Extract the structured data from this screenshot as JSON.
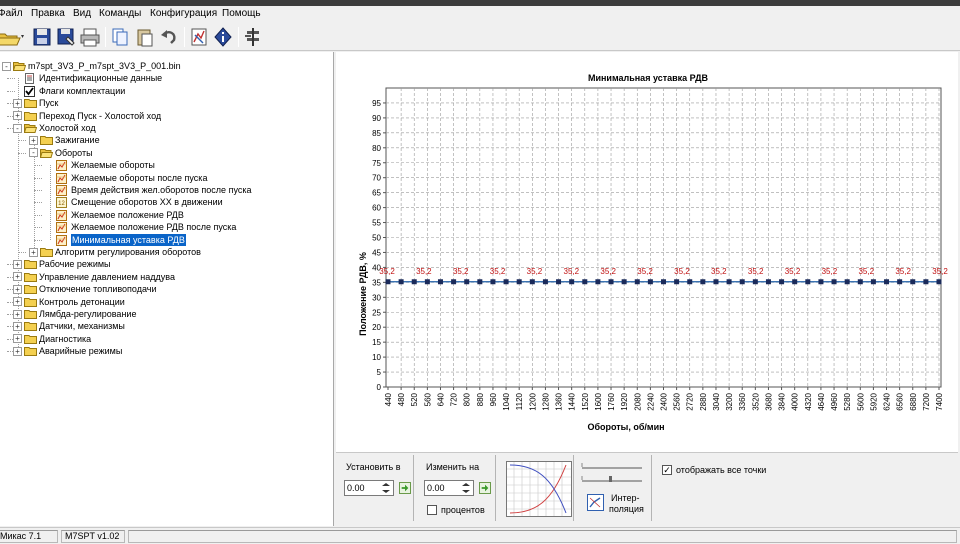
{
  "menu": [
    {
      "label": "Файл"
    },
    {
      "label": "Правка"
    },
    {
      "label": "Вид"
    },
    {
      "label": "Команды"
    },
    {
      "label": "Конфигурация"
    },
    {
      "label": "Помощь"
    }
  ],
  "tree": {
    "root": "m7spt_3V3_P_m7spt_3V3_P_001.bin",
    "nodes": [
      {
        "label": "Идентификационные данные",
        "icon": "id-icon"
      },
      {
        "label": "Флаги комплектации",
        "icon": "checkmark-icon"
      },
      {
        "label": "Пуск",
        "icon": "folder-icon"
      },
      {
        "label": "Переход Пуск - Холостой ход",
        "icon": "folder-icon"
      },
      {
        "label": "Холостой ход",
        "icon": "folder-open-icon"
      },
      {
        "label": "Зажигание",
        "icon": "folder-icon"
      },
      {
        "label": "Обороты",
        "icon": "folder-open-icon"
      },
      {
        "label": "Желаемые обороты",
        "icon": "table-icon"
      },
      {
        "label": "Желаемые обороты после пуска",
        "icon": "table-icon"
      },
      {
        "label": "Время действия жел.оборотов после пуска",
        "icon": "table-icon"
      },
      {
        "label": "Смещение оборотов ХХ в движении",
        "icon": "const-icon"
      },
      {
        "label": "Желаемое положение РДВ",
        "icon": "table-icon"
      },
      {
        "label": "Желаемое положение РДВ после пуска",
        "icon": "table-icon"
      },
      {
        "label": "Минимальная уставка РДВ",
        "icon": "table-icon"
      },
      {
        "label": "Алгоритм регулирования оборотов",
        "icon": "folder-icon"
      },
      {
        "label": "Рабочие режимы",
        "icon": "folder-icon"
      },
      {
        "label": "Управление давлением наддува",
        "icon": "folder-icon"
      },
      {
        "label": "Отключение топливоподачи",
        "icon": "folder-icon"
      },
      {
        "label": "Контроль детонации",
        "icon": "folder-icon"
      },
      {
        "label": "Лямбда-регулирование",
        "icon": "folder-icon"
      },
      {
        "label": "Датчики, механизмы",
        "icon": "folder-icon"
      },
      {
        "label": "Диагностика",
        "icon": "folder-icon"
      },
      {
        "label": "Аварийные режимы",
        "icon": "folder-icon"
      }
    ]
  },
  "chart_data": {
    "type": "line",
    "title": "Минимальная уставка РДВ",
    "xlabel": "Обороты, об/мин",
    "ylabel": "Положение РДВ, %",
    "x": [
      440,
      480,
      520,
      560,
      600,
      640,
      680,
      720,
      760,
      800,
      840,
      880,
      920,
      960,
      1000,
      1040,
      1080,
      1120,
      1160,
      1200,
      1240,
      1280,
      1320,
      1360,
      1400,
      1440,
      1480,
      1520,
      1560,
      1600,
      1680,
      1760,
      1840,
      1920,
      2000,
      2080,
      2160,
      2240,
      2320,
      2400,
      2480,
      2560,
      2640,
      2720,
      2800,
      2880,
      2960,
      3040,
      3120,
      3200,
      3280,
      3360,
      3440,
      3520,
      3600,
      3680,
      3760,
      3840,
      3920,
      4000,
      4160,
      4320,
      4480,
      4640,
      4800,
      4960,
      5120,
      5280,
      5440,
      5600,
      5760,
      5920,
      6080,
      6240,
      6400,
      6560,
      6720,
      6880,
      7040,
      7200,
      7400
    ],
    "x_tick_labels": [
      "440",
      "480",
      "520",
      "560",
      "640",
      "720",
      "800",
      "880",
      "960",
      "1040",
      "1120",
      "1200",
      "1280",
      "1360",
      "1440",
      "1520",
      "1600",
      "1760",
      "1920",
      "2080",
      "2240",
      "2400",
      "2560",
      "2720",
      "2880",
      "3040",
      "3200",
      "3360",
      "3520",
      "3680",
      "3840",
      "4000",
      "4320",
      "4640",
      "4960",
      "5280",
      "5600",
      "5920",
      "6240",
      "6560",
      "6880",
      "7200",
      "7400"
    ],
    "series": [
      {
        "values": [
          35.2,
          35.2,
          35.2,
          35.2,
          35.2,
          35.2,
          35.2,
          35.2,
          35.2,
          35.2,
          35.2,
          35.2,
          35.2,
          35.2,
          35.2,
          35.2,
          35.2,
          35.2,
          35.2,
          35.2,
          35.2,
          35.2,
          35.2,
          35.2,
          35.2,
          35.2,
          35.2,
          35.2,
          35.2,
          35.2,
          35.2,
          35.2,
          35.2,
          35.2,
          35.2,
          35.2,
          35.2,
          35.2,
          35.2,
          35.2,
          35.2,
          35.2,
          35.2
        ],
        "color": "#1f5fa8"
      }
    ],
    "point_labels": [
      "35,2",
      "35,2",
      "35,2",
      "35,2",
      "35,2",
      "35,2",
      "35,2",
      "35,2",
      "35,2",
      "35,2",
      "35,2",
      "35,2",
      "35,2",
      "35,2",
      "35,2",
      "35,2"
    ],
    "ylim": [
      0,
      100
    ],
    "y_ticks": [
      0,
      5,
      10,
      15,
      20,
      25,
      30,
      35,
      40,
      45,
      50,
      55,
      60,
      65,
      70,
      75,
      80,
      85,
      90,
      95
    ],
    "grid": true,
    "label_color": "#c01010"
  },
  "controls": {
    "set_to_label": "Установить в",
    "set_to_value": "0.00",
    "change_by_label": "Изменить на",
    "change_by_value": "0.00",
    "percent_label": "процентов",
    "interp_label_1": "Интер-",
    "interp_label_2": "поляция",
    "show_all_points_label": "отображать все точки",
    "show_all_points_checked": true,
    "percent_checked": false
  },
  "status": {
    "app": "Микас 7.1",
    "version": "M7SPT v1.02"
  }
}
